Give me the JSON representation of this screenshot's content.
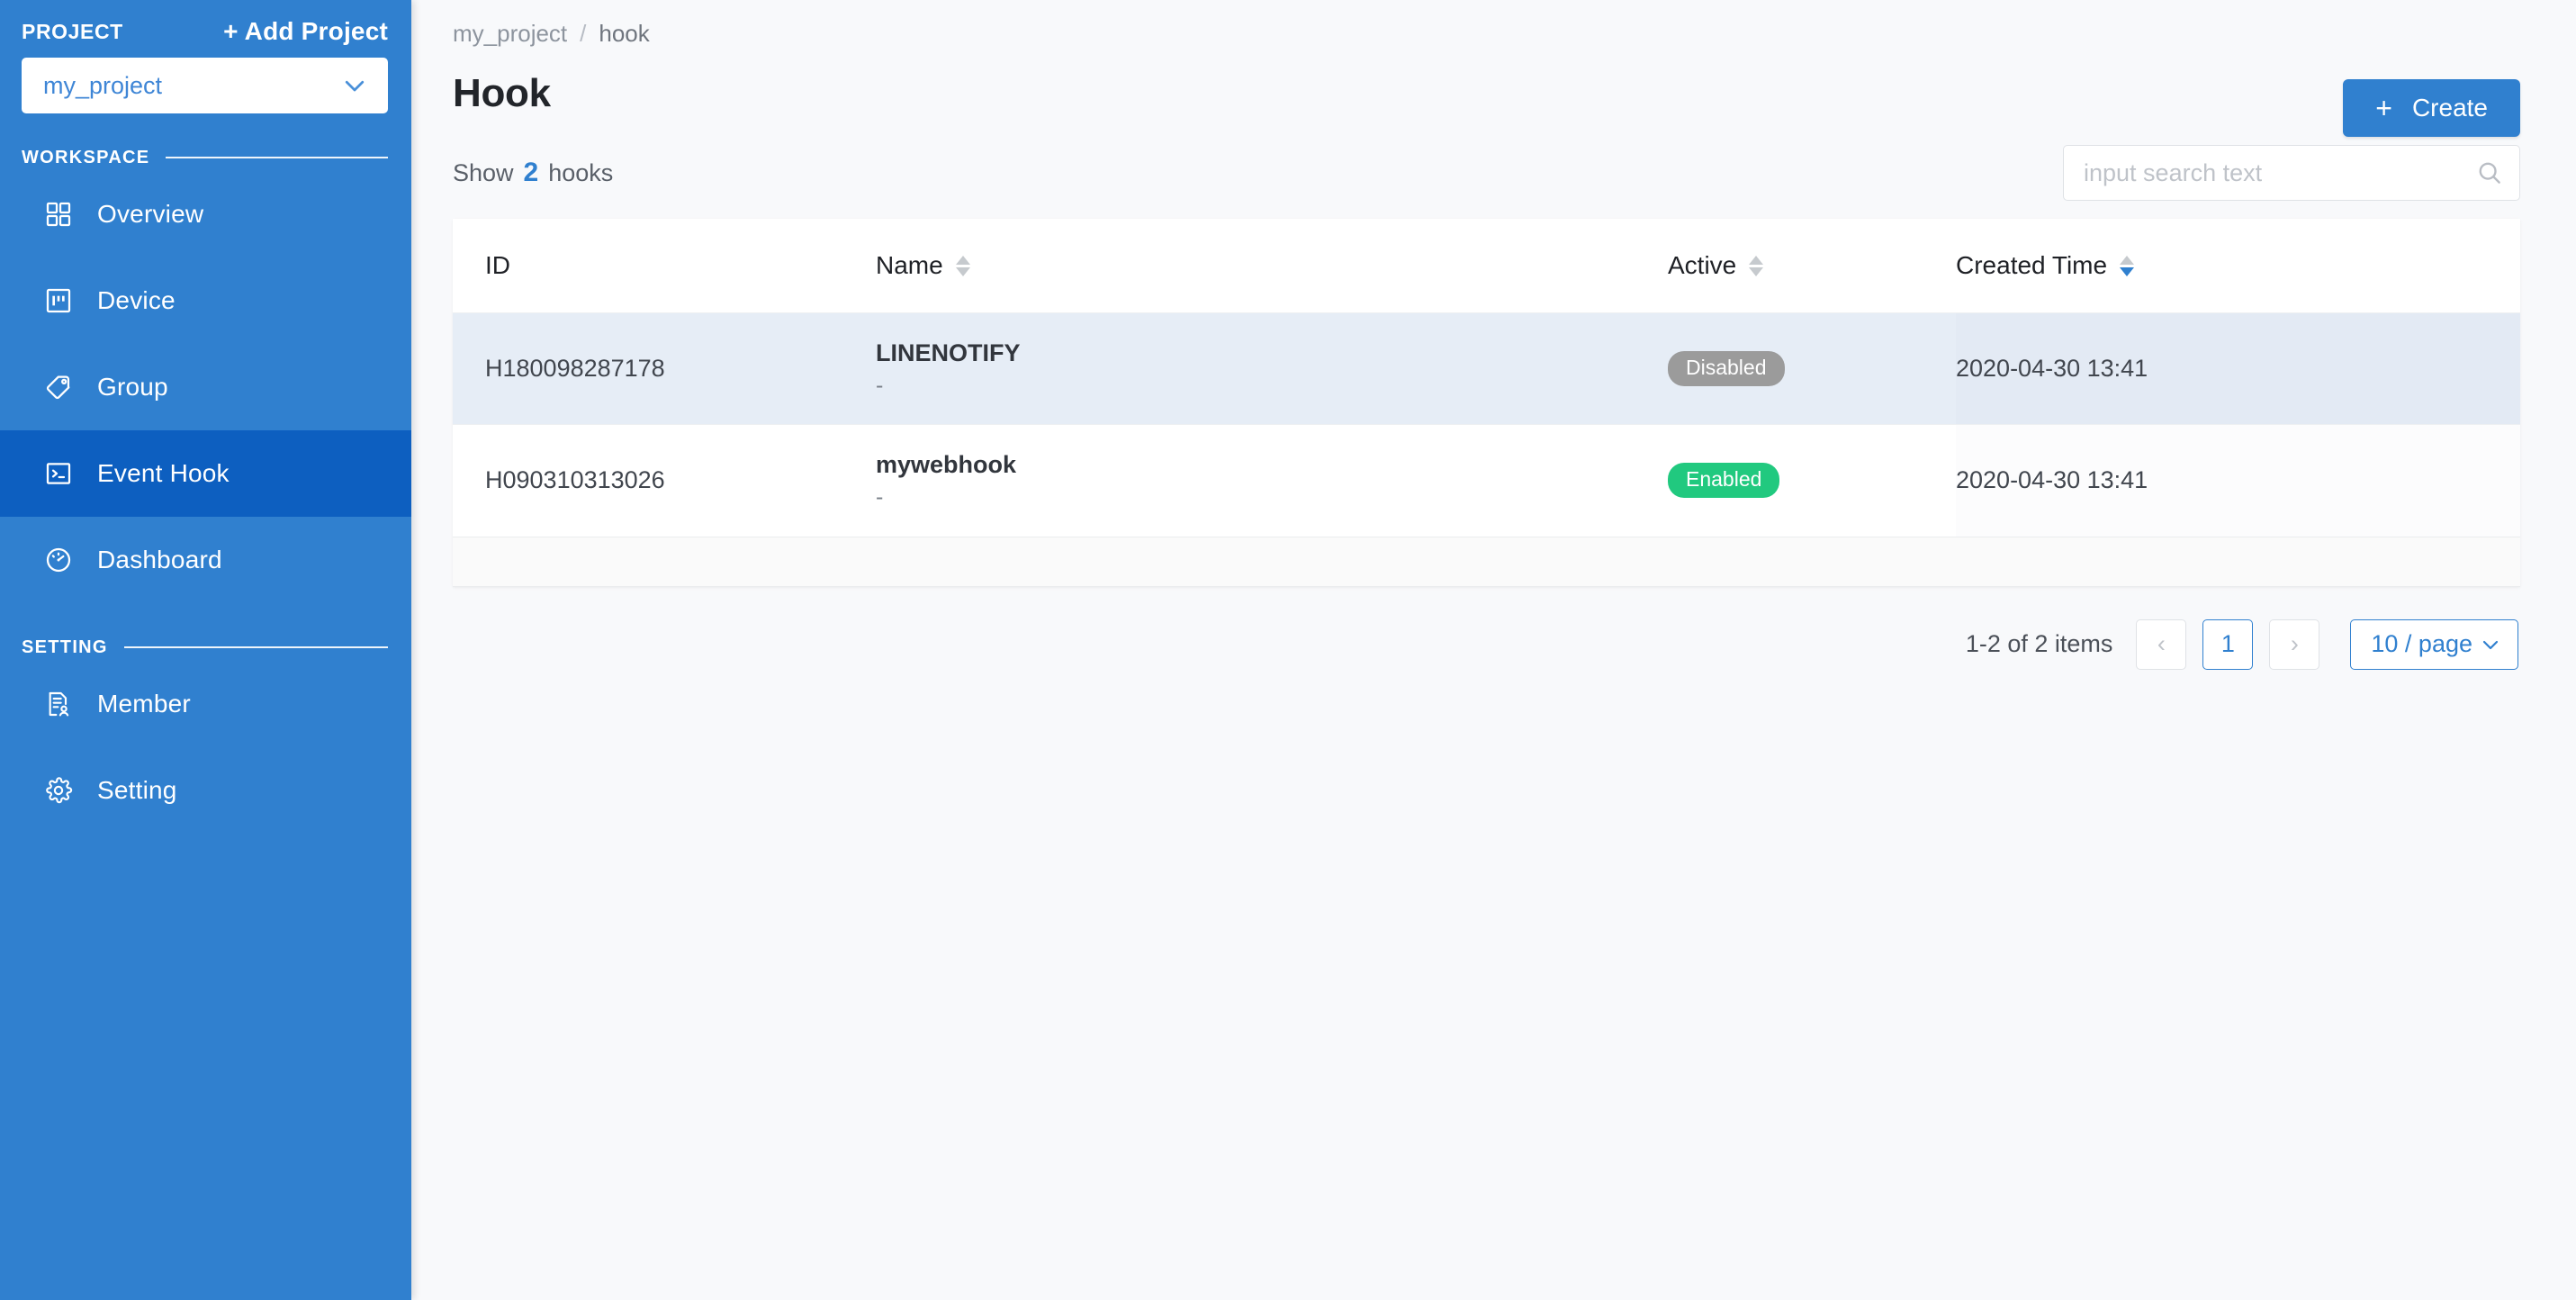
{
  "sidebar": {
    "project_label": "PROJECT",
    "add_project_label": "+ Add Project",
    "project_selected": "my_project",
    "sections": [
      {
        "title": "WORKSPACE"
      },
      {
        "title": "SETTING"
      }
    ],
    "workspace_items": [
      {
        "label": "Overview",
        "icon": "grid-icon",
        "active": false
      },
      {
        "label": "Device",
        "icon": "device-icon",
        "active": false
      },
      {
        "label": "Group",
        "icon": "tag-icon",
        "active": false
      },
      {
        "label": "Event Hook",
        "icon": "terminal-icon",
        "active": true
      },
      {
        "label": "Dashboard",
        "icon": "gauge-icon",
        "active": false
      }
    ],
    "setting_items": [
      {
        "label": "Member",
        "icon": "member-icon",
        "active": false
      },
      {
        "label": "Setting",
        "icon": "gear-icon",
        "active": false
      }
    ]
  },
  "header": {
    "breadcrumb_root": "my_project",
    "breadcrumb_sep": "/",
    "breadcrumb_current": "hook",
    "title": "Hook",
    "create_label": "Create",
    "create_plus": "+"
  },
  "toolbar": {
    "show_prefix": "Show",
    "show_count": "2",
    "show_suffix": "hooks",
    "search_placeholder": "input search text",
    "search_value": ""
  },
  "table": {
    "columns": [
      {
        "key": "id",
        "label": "ID",
        "sortable": false,
        "sort": "none"
      },
      {
        "key": "name",
        "label": "Name",
        "sortable": true,
        "sort": "none"
      },
      {
        "key": "active",
        "label": "Active",
        "sortable": true,
        "sort": "none"
      },
      {
        "key": "time",
        "label": "Created Time",
        "sortable": true,
        "sort": "desc"
      }
    ],
    "rows": [
      {
        "id": "H180098287178",
        "name": "LINENOTIFY",
        "name_sub": "-",
        "active_label": "Disabled",
        "active_state": "disabled",
        "created_time": "2020-04-30 13:41",
        "selected": true
      },
      {
        "id": "H090310313026",
        "name": "mywebhook",
        "name_sub": "-",
        "active_label": "Enabled",
        "active_state": "enabled",
        "created_time": "2020-04-30 13:41",
        "selected": false
      }
    ]
  },
  "pagination": {
    "total_text": "1-2 of 2 items",
    "prev_label": "‹",
    "next_label": "›",
    "current_page": "1",
    "page_size_label": "10 / page"
  },
  "colors": {
    "sidebar_bg": "#3080cf",
    "sidebar_active": "#0d5fc0",
    "accent": "#3080cf",
    "enabled": "#21c97f",
    "disabled": "#9b9b9b",
    "page_bg": "#f8f9fb",
    "row_selected": "#e6edf6"
  }
}
